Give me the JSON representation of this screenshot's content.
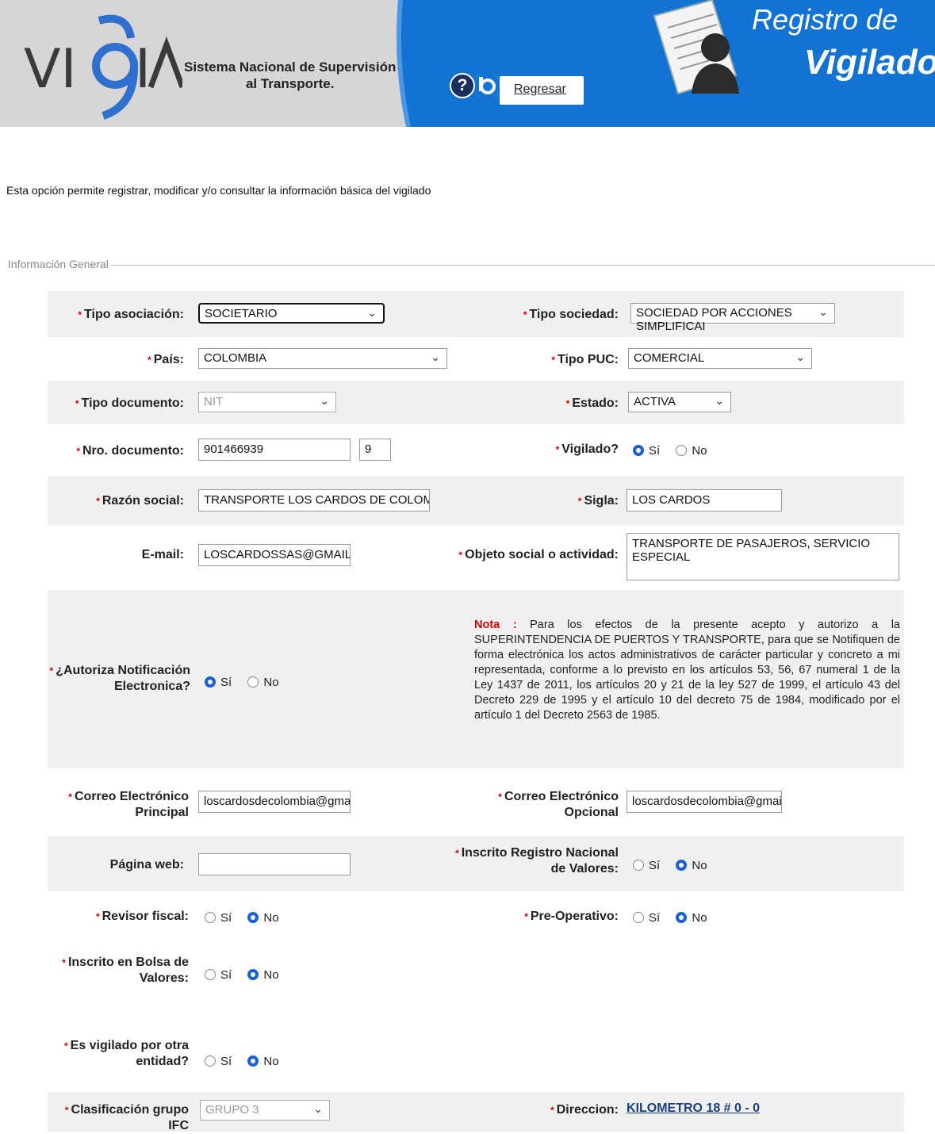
{
  "header": {
    "logo": "VIGIA",
    "system_line1": "Sistema Nacional de Supervisión",
    "system_line2": "al Transporte.",
    "help_icon": "question-icon",
    "back_label": "Regresar",
    "title_line1": "Registro de",
    "title_line2": "Vigilados"
  },
  "intro": "Esta opción permite registrar, modificar y/o consultar la información básica del vigilado",
  "section_legend": "Información General",
  "required_mark": "*",
  "colors": {
    "header_blue": "#1273d3",
    "accent_red": "#cc0000",
    "radio_blue": "#1a5fd6"
  },
  "form": {
    "tipo_asociacion": {
      "label": "Tipo asociación:",
      "value": "SOCIETARIO"
    },
    "tipo_sociedad": {
      "label": "Tipo sociedad:",
      "value": "SOCIEDAD POR ACCIONES SIMPLIFICAI"
    },
    "pais": {
      "label": "País:",
      "value": "COLOMBIA"
    },
    "tipo_puc": {
      "label": "Tipo PUC:",
      "value": "COMERCIAL"
    },
    "tipo_documento": {
      "label": "Tipo documento:",
      "value": "NIT"
    },
    "estado": {
      "label": "Estado:",
      "value": "ACTIVA"
    },
    "nro_documento": {
      "label": "Nro. documento:",
      "value": "901466939",
      "dv": "9"
    },
    "vigilado": {
      "label": "Vigilado?",
      "yes": "Sí",
      "no": "No",
      "selected": "Sí"
    },
    "razon_social": {
      "label": "Razón social:",
      "value": "TRANSPORTE LOS CARDOS DE COLOMBIA SAS"
    },
    "sigla": {
      "label": "Sigla:",
      "value": "LOS CARDOS"
    },
    "email": {
      "label": "E-mail:",
      "value": "LOSCARDOSSAS@GMAIL.COM"
    },
    "objeto_social": {
      "label": "Objeto social o actividad:",
      "value": "TRANSPORTE DE PASAJEROS, SERVICIO ESPECIAL"
    },
    "autoriza_notificacion": {
      "label_line1": "¿Autoriza Notificación",
      "label_line2": "Electronica?",
      "yes": "Sí",
      "no": "No",
      "selected": "Sí"
    },
    "nota": {
      "title": "Nota :",
      "text": "Para los efectos de la presente acepto y autorizo a la SUPERINTENDENCIA DE PUERTOS Y TRANSPORTE, para que se Notifiquen de forma electrónica los actos administrativos de carácter particular y concreto a mi representada, conforme a lo previsto en los artículos 53, 56, 67 numeral 1 de la Ley 1437 de 2011, los artículos 20 y 21 de la ley 527 de 1999, el artículo 43 del Decreto 229 de 1995 y el artículo 10 del decreto 75 de 1984, modificado por el artículo 1 del Decreto 2563 de 1985."
    },
    "correo_principal": {
      "label_line1": "Correo Electrónico",
      "label_line2": "Principal",
      "value": "loscardosdecolombia@gmail.c"
    },
    "correo_opcional": {
      "label_line1": "Correo Electrónico",
      "label_line2": "Opcional",
      "value": "loscardosdecolombia@gmail.c"
    },
    "pagina_web": {
      "label": "Página web:",
      "value": ""
    },
    "inscrito_rnv": {
      "label_line1": "Inscrito Registro Nacional",
      "label_line2": "de Valores:",
      "yes": "Sí",
      "no": "No",
      "selected": "No"
    },
    "revisor_fiscal": {
      "label": "Revisor fiscal:",
      "yes": "Sí",
      "no": "No",
      "selected": "No"
    },
    "pre_operativo": {
      "label": "Pre-Operativo:",
      "yes": "Sí",
      "no": "No",
      "selected": "No"
    },
    "bolsa_valores": {
      "label_line1": "Inscrito en Bolsa de",
      "label_line2": "Valores:",
      "yes": "Sí",
      "no": "No",
      "selected": "No"
    },
    "otra_entidad": {
      "label_line1": "Es vigilado por otra",
      "label_line2": "entidad?",
      "yes": "Sí",
      "no": "No",
      "selected": "No"
    },
    "clasificacion_ifc": {
      "label": "Clasificación grupo IFC",
      "value": "GRUPO 3"
    },
    "direccion": {
      "label": "Direccion:",
      "value": "KILOMETRO 18 # 0 - 0"
    }
  }
}
